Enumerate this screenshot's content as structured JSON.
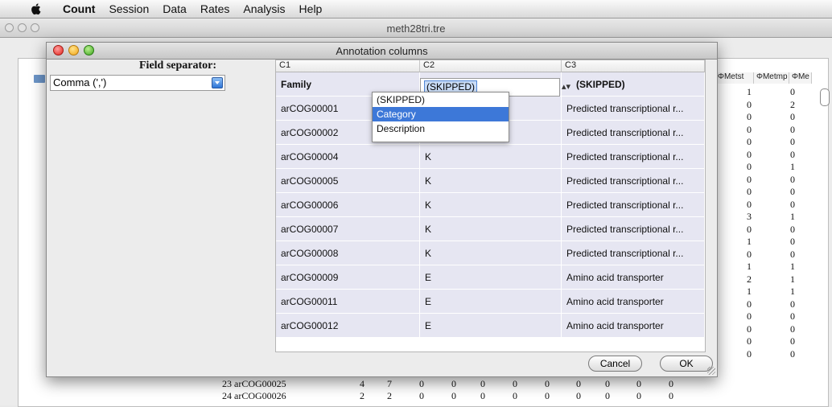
{
  "menubar": {
    "app": "Count",
    "items": [
      "Session",
      "Data",
      "Rates",
      "Analysis",
      "Help"
    ]
  },
  "main_window": {
    "title": "meth28tri.tre",
    "right_headers": [
      "ΦMetst",
      "ΦMetmp",
      "ΦMe"
    ],
    "right_col1": [
      "1",
      "0",
      "0",
      "0",
      "0",
      "0",
      "0",
      "0",
      "0",
      "0",
      "3",
      "0",
      "1",
      "0",
      "1",
      "2",
      "1",
      "0",
      "0",
      "0",
      "0",
      "0"
    ],
    "right_col2": [
      "0",
      "2",
      "0",
      "0",
      "0",
      "0",
      "1",
      "0",
      "0",
      "0",
      "1",
      "0",
      "0",
      "0",
      "1",
      "1",
      "1",
      "0",
      "0",
      "0",
      "0",
      "0"
    ],
    "bottom_rows": [
      {
        "label": "23 arCOG00025",
        "values": [
          "4",
          "7",
          "0",
          "0",
          "0",
          "0",
          "0",
          "0",
          "0",
          "0",
          "0"
        ]
      },
      {
        "label": "24 arCOG00026",
        "values": [
          "2",
          "2",
          "0",
          "0",
          "0",
          "0",
          "0",
          "0",
          "0",
          "0",
          "0"
        ]
      }
    ]
  },
  "dialog": {
    "title": "Annotation columns",
    "field_separator_label": "Field separator:",
    "field_separator_value": "Comma (',')",
    "column_headers": [
      "C1",
      "C2",
      "C3"
    ],
    "header_row": {
      "c1": "Family",
      "c2": "(SKIPPED)",
      "c3": "(SKIPPED)"
    },
    "rows": [
      {
        "c1": "arCOG00001",
        "c2": "",
        "c3": "Predicted transcriptional r..."
      },
      {
        "c1": "arCOG00002",
        "c2": "",
        "c3": "Predicted transcriptional r..."
      },
      {
        "c1": "arCOG00004",
        "c2": "K",
        "c3": "Predicted transcriptional r..."
      },
      {
        "c1": "arCOG00005",
        "c2": "K",
        "c3": "Predicted transcriptional r..."
      },
      {
        "c1": "arCOG00006",
        "c2": "K",
        "c3": "Predicted transcriptional r..."
      },
      {
        "c1": "arCOG00007",
        "c2": "K",
        "c3": "Predicted transcriptional r..."
      },
      {
        "c1": "arCOG00008",
        "c2": "K",
        "c3": "Predicted transcriptional r..."
      },
      {
        "c1": "arCOG00009",
        "c2": "E",
        "c3": "Amino acid transporter"
      },
      {
        "c1": "arCOG00011",
        "c2": "E",
        "c3": "Amino acid transporter"
      },
      {
        "c1": "arCOG00012",
        "c2": "E",
        "c3": "Amino acid transporter"
      }
    ],
    "dropdown_options": [
      "(SKIPPED)",
      "Category",
      "Description"
    ],
    "dropdown_selected": "Category",
    "cancel_label": "Cancel",
    "ok_label": "OK"
  }
}
